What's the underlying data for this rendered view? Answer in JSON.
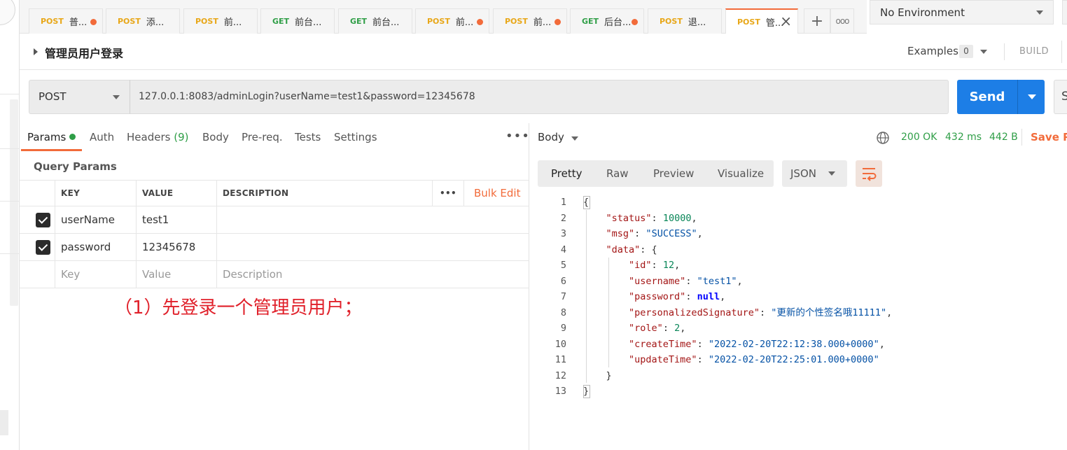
{
  "tabs": [
    {
      "method": "POST",
      "name": "普...",
      "modified": true
    },
    {
      "method": "POST",
      "name": "添...",
      "modified": false
    },
    {
      "method": "POST",
      "name": "前...",
      "modified": false
    },
    {
      "method": "GET",
      "name": "前台...",
      "modified": false
    },
    {
      "method": "GET",
      "name": "前台...",
      "modified": false
    },
    {
      "method": "POST",
      "name": "前...",
      "modified": true
    },
    {
      "method": "POST",
      "name": "前...",
      "modified": true
    },
    {
      "method": "GET",
      "name": "后台...",
      "modified": true
    },
    {
      "method": "POST",
      "name": "退...",
      "modified": false
    },
    {
      "method": "POST",
      "name": "管...",
      "modified": false,
      "active": true
    }
  ],
  "tab_add_icon": "+",
  "tab_more_icon": "ooo",
  "environment": "No Environment",
  "request": {
    "title": "管理员用户登录",
    "examples_label": "Examples",
    "examples_count": "0",
    "build_label": "BUILD",
    "method": "POST",
    "url": "127.0.0.1:8083/adminLogin?userName=test1&password=12345678",
    "send_label": "Send",
    "save_label": "S"
  },
  "request_tabs": [
    {
      "label": "Params",
      "active": true
    },
    {
      "label": "Auth"
    },
    {
      "label": "Headers",
      "count": "(9)"
    },
    {
      "label": "Body"
    },
    {
      "label": "Pre-req."
    },
    {
      "label": "Tests"
    },
    {
      "label": "Settings"
    }
  ],
  "query_params": {
    "title": "Query Params",
    "headers": {
      "key": "KEY",
      "value": "VALUE",
      "description": "DESCRIPTION",
      "bulk_edit": "Bulk Edit"
    },
    "rows": [
      {
        "checked": true,
        "key": "userName",
        "value": "test1",
        "description": ""
      },
      {
        "checked": true,
        "key": "password",
        "value": "12345678",
        "description": ""
      }
    ],
    "placeholder": {
      "key": "Key",
      "value": "Value",
      "description": "Description"
    }
  },
  "annotation": "（1）先登录一个管理员用户；",
  "response": {
    "body_label": "Body",
    "status": "200 OK",
    "time": "432 ms",
    "size": "442 B",
    "save_label": "Save Re",
    "view_tabs": [
      "Pretty",
      "Raw",
      "Preview",
      "Visualize"
    ],
    "format": "JSON",
    "lines": [
      {
        "n": "1"
      },
      {
        "n": "2"
      },
      {
        "n": "3"
      },
      {
        "n": "4"
      },
      {
        "n": "5"
      },
      {
        "n": "6"
      },
      {
        "n": "7"
      },
      {
        "n": "8"
      },
      {
        "n": "9"
      },
      {
        "n": "10"
      },
      {
        "n": "11"
      },
      {
        "n": "12"
      },
      {
        "n": "13"
      }
    ],
    "json": {
      "status": 10000,
      "msg": "SUCCESS",
      "data": {
        "id": 12,
        "username": "test1",
        "password": "null",
        "personalizedSignature": "更新的个性签名哦11111",
        "role": 2,
        "createTime": "2022-02-20T22:12:38.000+0000",
        "updateTime": "2022-02-20T22:25:01.000+0000"
      }
    }
  },
  "colors": {
    "accent": "#f26b3a",
    "send": "#1d7ee6",
    "ok": "#2f9e47",
    "annotation": "#e0202a"
  }
}
